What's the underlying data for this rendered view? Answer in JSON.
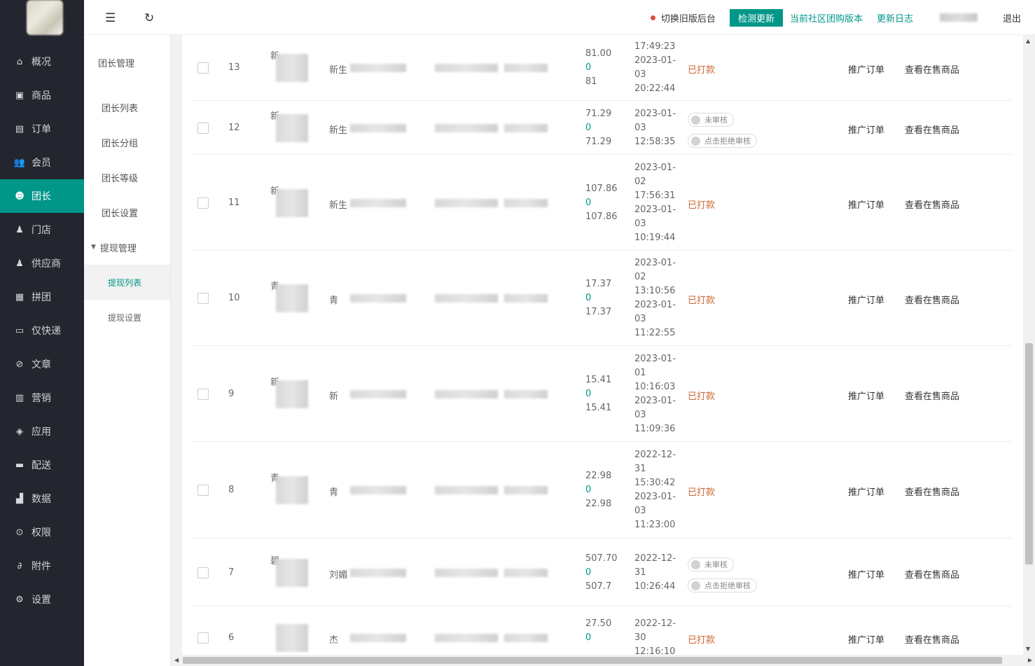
{
  "nav": {
    "items": [
      {
        "label": "概况",
        "icon": "home-icon",
        "glyph": "⌂"
      },
      {
        "label": "商品",
        "icon": "goods-icon",
        "glyph": "▣"
      },
      {
        "label": "订单",
        "icon": "order-icon",
        "glyph": "▤"
      },
      {
        "label": "会员",
        "icon": "member-icon",
        "glyph": "👥"
      },
      {
        "label": "团长",
        "icon": "leader-icon",
        "glyph": "☻"
      },
      {
        "label": "门店",
        "icon": "store-icon",
        "glyph": "♟"
      },
      {
        "label": "供应商",
        "icon": "supplier-icon",
        "glyph": "♟"
      },
      {
        "label": "拼团",
        "icon": "group-buy-icon",
        "glyph": "▦"
      },
      {
        "label": "仅快递",
        "icon": "express-icon",
        "glyph": "▭"
      },
      {
        "label": "文章",
        "icon": "article-icon",
        "glyph": "⊘"
      },
      {
        "label": "营销",
        "icon": "marketing-icon",
        "glyph": "▥"
      },
      {
        "label": "应用",
        "icon": "app-icon",
        "glyph": "◈"
      },
      {
        "label": "配送",
        "icon": "delivery-icon",
        "glyph": "▬"
      },
      {
        "label": "数据",
        "icon": "data-icon",
        "glyph": "▟"
      },
      {
        "label": "权限",
        "icon": "permission-icon",
        "glyph": "⊙"
      },
      {
        "label": "附件",
        "icon": "attachment-icon",
        "glyph": "∂"
      },
      {
        "label": "设置",
        "icon": "settings-icon",
        "glyph": "⚙"
      }
    ],
    "active_index": 4
  },
  "submenu": {
    "title": "团长管理",
    "items": [
      "团长列表",
      "团长分组",
      "团长等级",
      "团长设置"
    ],
    "group": "提现管理",
    "children": [
      "提现列表",
      "提现设置"
    ]
  },
  "header": {
    "menu_icon": "☰",
    "refresh_icon": "↻",
    "switch_label": "切换旧版后台",
    "check_update": "检测更新",
    "version_link": "当前社区团购版本",
    "changelog": "更新日志",
    "logout": "退出"
  },
  "table": {
    "rows": [
      {
        "id": "13",
        "name_prefix": "新",
        "leader_prefix": "新生",
        "amount": "81.00",
        "fee": "0",
        "actual": "81",
        "dates": [
          "17:49:23",
          "2023-01-",
          "03",
          "20:22:44"
        ],
        "status": "已打款"
      },
      {
        "id": "12",
        "name_prefix": "新",
        "leader_prefix": "新生",
        "amount": "71.29",
        "fee": "0",
        "actual": "71.29",
        "dates": [
          "2023-01-",
          "03",
          "12:58:35"
        ],
        "status": "",
        "pill1": "未审核",
        "pill2": "点击拒绝审核"
      },
      {
        "id": "11",
        "name_prefix": "新",
        "leader_prefix": "新生",
        "amount": "107.86",
        "fee": "0",
        "actual": "107.86",
        "dates": [
          "2023-01-",
          "02",
          "17:56:31",
          "2023-01-",
          "03",
          "10:19:44"
        ],
        "status": "已打款"
      },
      {
        "id": "10",
        "name_prefix": "青",
        "leader_prefix": "青",
        "amount": "17.37",
        "fee": "0",
        "actual": "17.37",
        "dates": [
          "2023-01-",
          "02",
          "13:10:56",
          "2023-01-",
          "03",
          "11:22:55"
        ],
        "status": "已打款"
      },
      {
        "id": "9",
        "name_prefix": "新",
        "leader_prefix": "新",
        "amount": "15.41",
        "fee": "0",
        "actual": "15.41",
        "dates": [
          "2023-01-",
          "01",
          "10:16:03",
          "2023-01-",
          "03",
          "11:09:36"
        ],
        "status": "已打款"
      },
      {
        "id": "8",
        "name_prefix": "青",
        "leader_prefix": "青",
        "amount": "22.98",
        "fee": "0",
        "actual": "22.98",
        "dates": [
          "2022-12-",
          "31",
          "15:30:42",
          "2023-01-",
          "03",
          "11:23:00"
        ],
        "status": "已打款"
      },
      {
        "id": "7",
        "name_prefix": "碧",
        "leader_prefix": "刘媚",
        "amount": "507.70",
        "fee": "0",
        "actual": "507.7",
        "dates": [
          "2022-12-",
          "31",
          "10:26:44"
        ],
        "status": "",
        "pill1": "未审核",
        "pill2": "点击拒绝审核"
      },
      {
        "id": "6",
        "name_prefix": "",
        "leader_prefix": "杰",
        "amount": "27.50",
        "fee": "0",
        "actual": "",
        "dates": [
          "2022-12-",
          "30",
          "12:16:10"
        ],
        "status": "已打款"
      }
    ],
    "op_orders": "推广订单",
    "op_goods": "查看在售商品"
  }
}
